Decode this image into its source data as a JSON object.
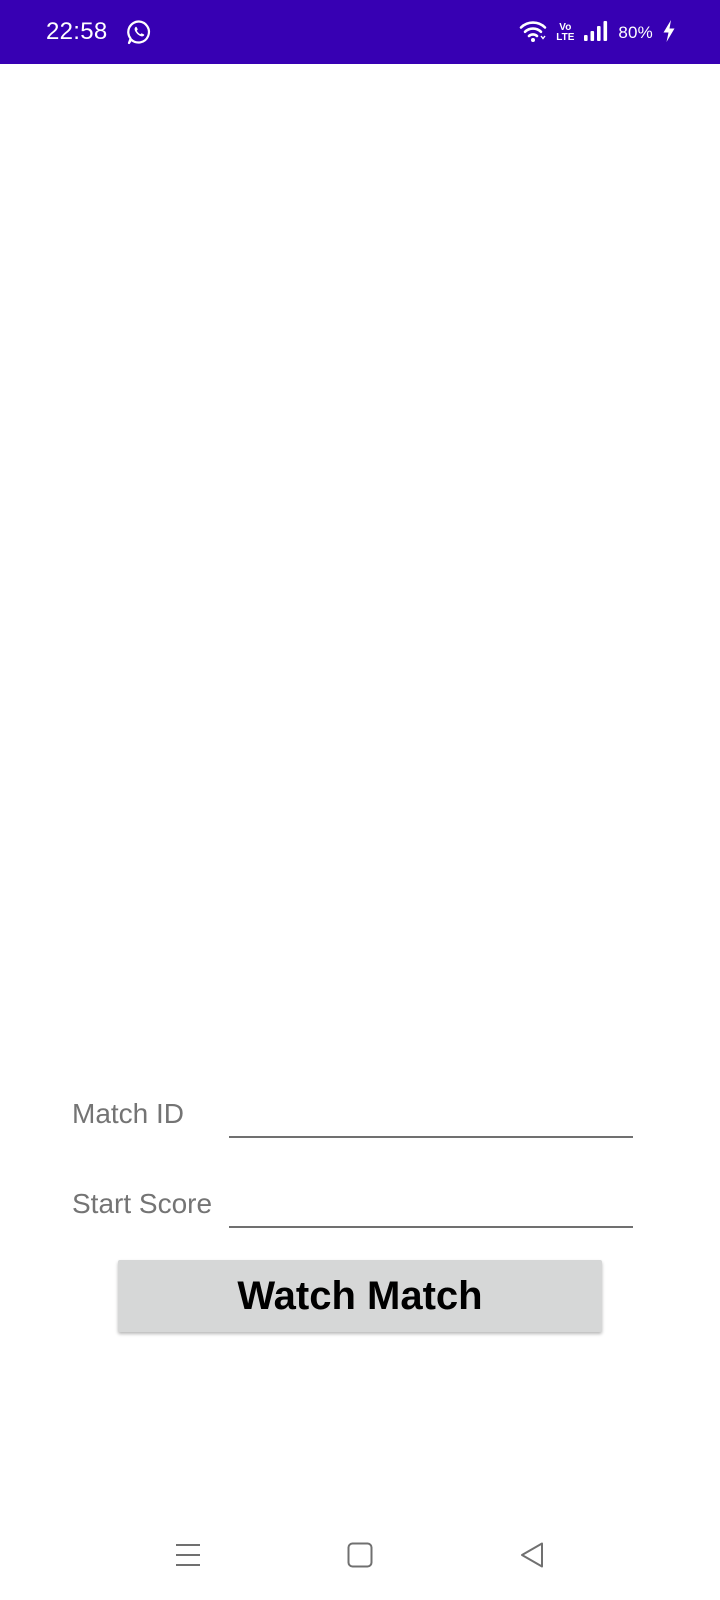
{
  "status_bar": {
    "time": "22:58",
    "battery": "80%",
    "background_color": "#3700b3",
    "icons": [
      "whatsapp-icon",
      "wifi-icon",
      "volte-icon",
      "signal-icon",
      "charging-icon"
    ],
    "volte_top": "Vo",
    "volte_bottom": "LTE"
  },
  "form": {
    "match_id_label": "Match ID",
    "match_id_value": "",
    "start_score_label": "Start Score",
    "start_score_value": ""
  },
  "actions": {
    "watch_button_label": "Watch Match"
  },
  "nav_bar": {
    "icons": [
      "menu-icon",
      "home-icon",
      "back-icon"
    ]
  }
}
